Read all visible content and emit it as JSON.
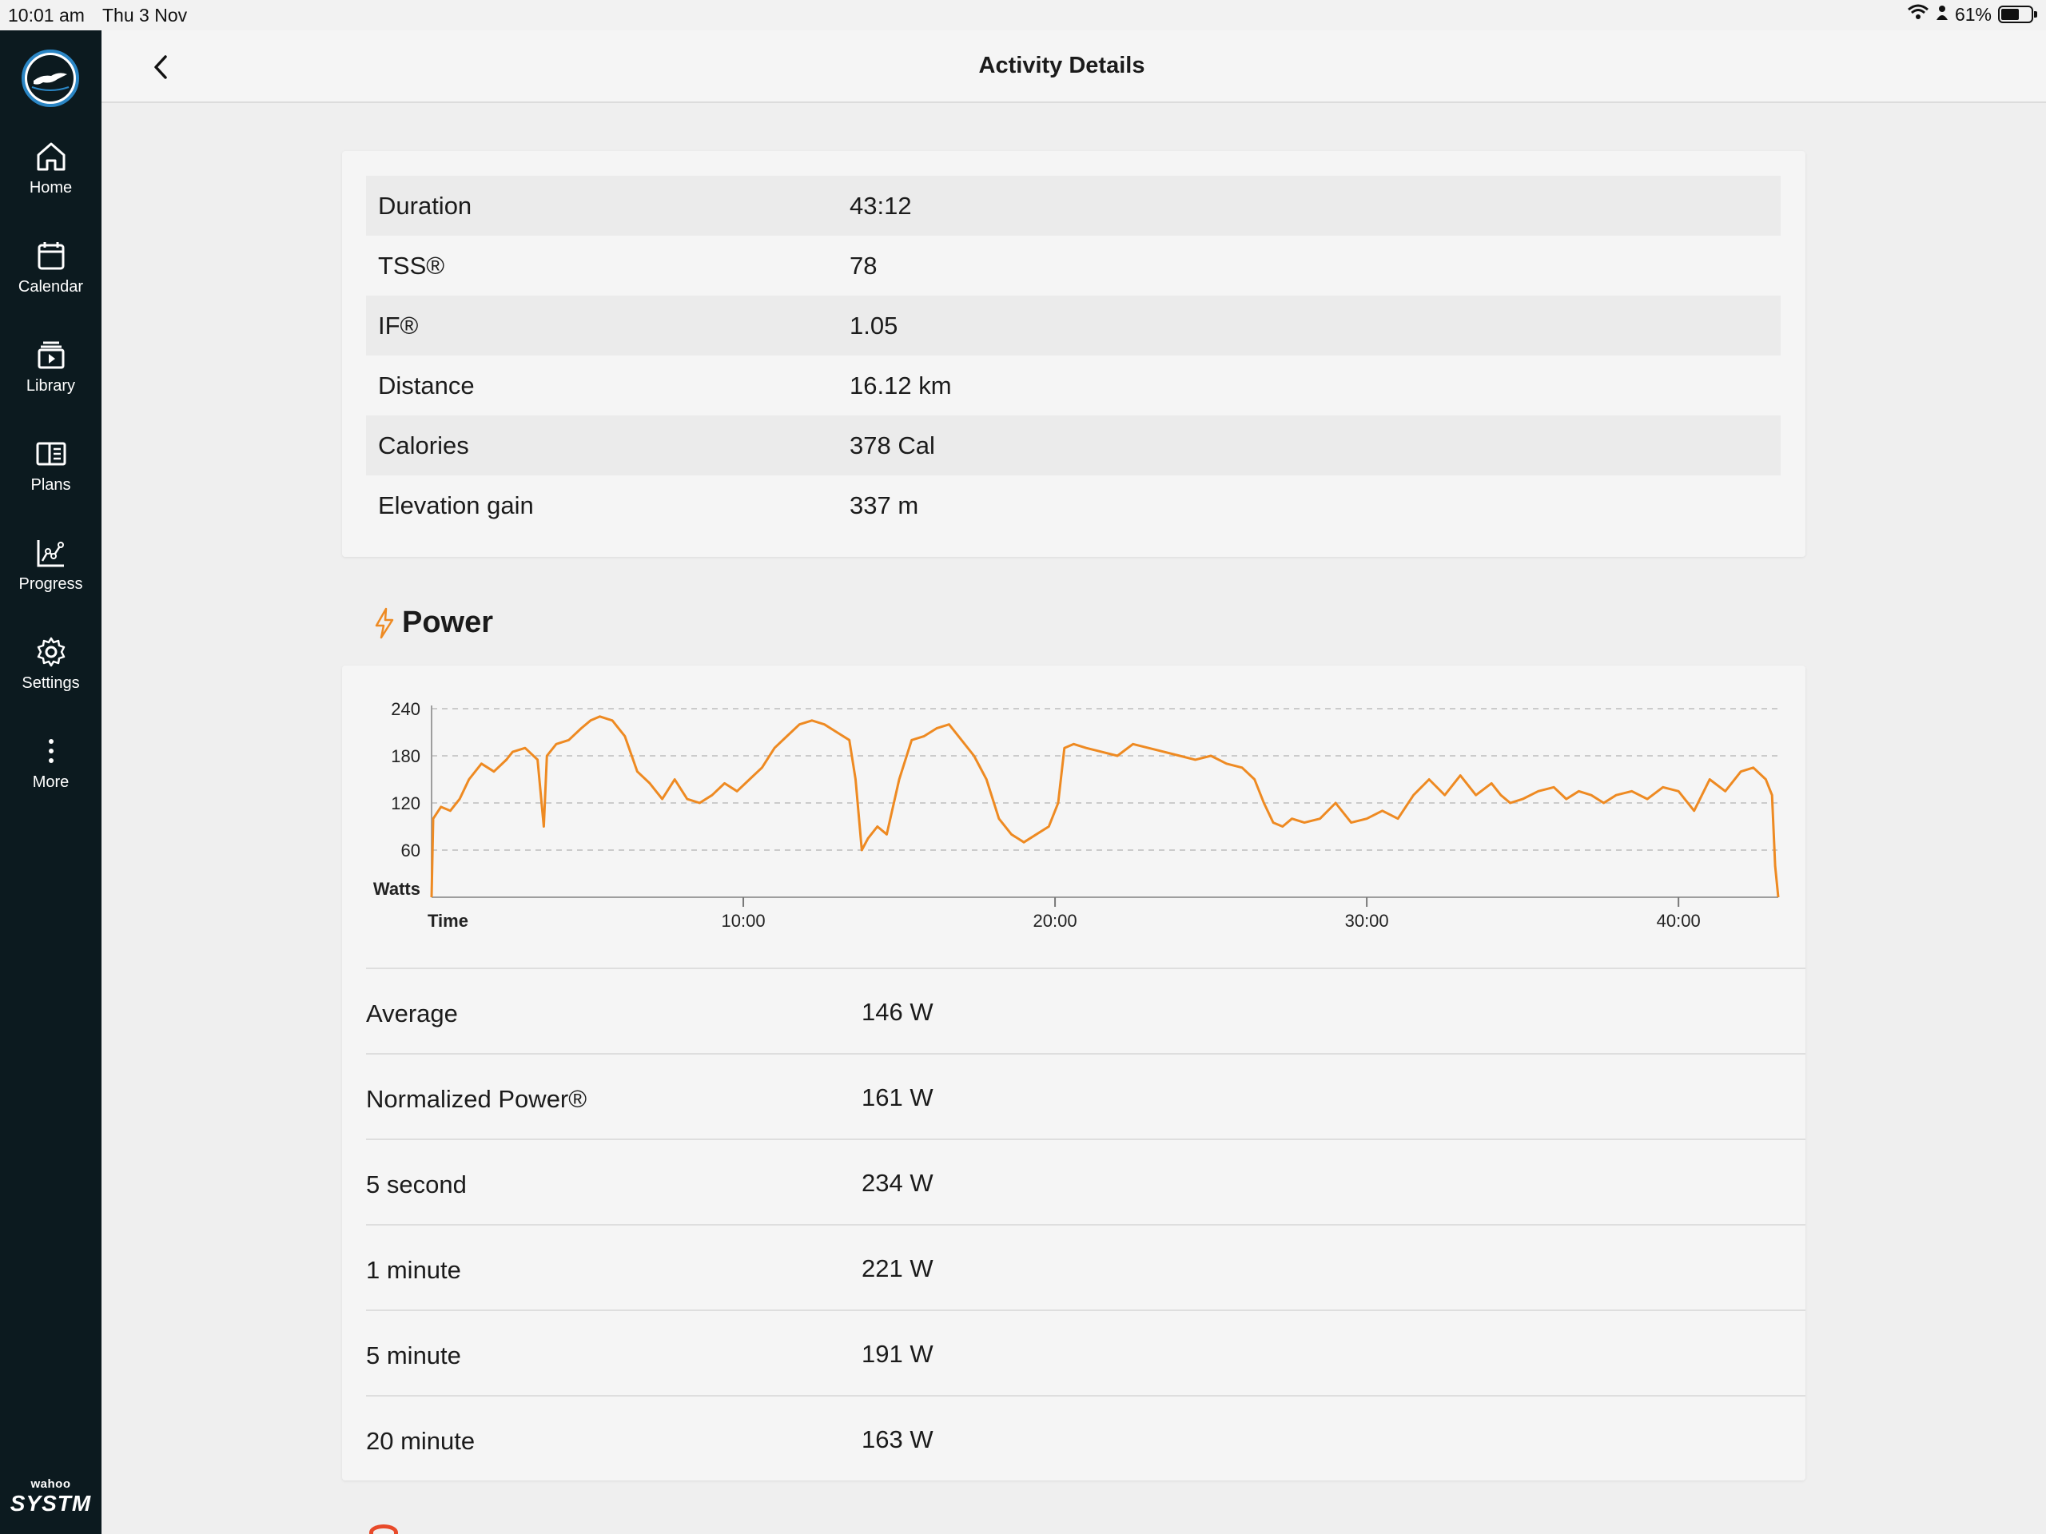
{
  "status_bar": {
    "time": "10:01 am",
    "date": "Thu 3 Nov",
    "battery": "61%",
    "battery_level": 0.61,
    "wifi_icon": "wifi-icon",
    "person_icon": "person-icon"
  },
  "sidebar": {
    "logo": "wahoo-logo",
    "items": [
      {
        "label": "Home",
        "icon": "home-icon"
      },
      {
        "label": "Calendar",
        "icon": "calendar-icon"
      },
      {
        "label": "Library",
        "icon": "library-icon"
      },
      {
        "label": "Plans",
        "icon": "plans-icon"
      },
      {
        "label": "Progress",
        "icon": "progress-icon"
      },
      {
        "label": "Settings",
        "icon": "gear-icon"
      },
      {
        "label": "More",
        "icon": "more-icon"
      }
    ],
    "brand_small": "wahoo",
    "brand_big": "SYSTM"
  },
  "header": {
    "title": "Activity Details",
    "back_icon": "chevron-left-icon"
  },
  "summary": {
    "rows": [
      {
        "label": "Duration",
        "value": "43:12"
      },
      {
        "label": "TSS®",
        "value": "78"
      },
      {
        "label": "IF®",
        "value": "1.05"
      },
      {
        "label": "Distance",
        "value": "16.12 km"
      },
      {
        "label": "Calories",
        "value": "378 Cal"
      },
      {
        "label": "Elevation gain",
        "value": "337 m"
      }
    ]
  },
  "power": {
    "heading": "Power",
    "icon": "lightning-icon",
    "accent_color": "#ee8a22",
    "stats": [
      {
        "label": "Average",
        "value": "146 W"
      },
      {
        "label": "Normalized Power®",
        "value": "161 W"
      },
      {
        "label": "5 second",
        "value": "234 W"
      },
      {
        "label": "1 minute",
        "value": "221 W"
      },
      {
        "label": "5 minute",
        "value": "191 W"
      },
      {
        "label": "20 minute",
        "value": "163 W"
      }
    ]
  },
  "chart_data": {
    "type": "line",
    "xlabel": "Time",
    "ylabel": "Watts",
    "x_unit": "minutes",
    "xlim": [
      0,
      43.2
    ],
    "ylim": [
      0,
      240
    ],
    "y_ticks": [
      60,
      120,
      180,
      240
    ],
    "x_ticks": [
      10,
      20,
      30,
      40
    ],
    "x_tick_labels": [
      "10:00",
      "20:00",
      "30:00",
      "40:00"
    ],
    "grid": true,
    "line_color": "#ee8a22",
    "series": [
      {
        "x": [
          0,
          0.05,
          0.3,
          0.6,
          0.9,
          1.2,
          1.6,
          2.0,
          2.4,
          2.6,
          3.0,
          3.4,
          3.6,
          3.7,
          4.0,
          4.4,
          4.8,
          5.1,
          5.4,
          5.8,
          6.2,
          6.6,
          7.0,
          7.4,
          7.8,
          8.2,
          8.6,
          9.0,
          9.4,
          9.8,
          10.2,
          10.6,
          11.0,
          11.4,
          11.8,
          12.2,
          12.6,
          13.0,
          13.4,
          13.6,
          13.8,
          14.0,
          14.3,
          14.6,
          15.0,
          15.4,
          15.8,
          16.2,
          16.6,
          17.0,
          17.4,
          17.8,
          18.2,
          18.6,
          19.0,
          19.4,
          19.8,
          20.1,
          20.3,
          20.6,
          21.0,
          21.5,
          22.0,
          22.5,
          23.0,
          23.5,
          24.0,
          24.5,
          25.0,
          25.5,
          26.0,
          26.4,
          26.7,
          27.0,
          27.3,
          27.6,
          28.0,
          28.5,
          29.0,
          29.5,
          30.0,
          30.5,
          31.0,
          31.5,
          32.0,
          32.5,
          33.0,
          33.5,
          34.0,
          34.3,
          34.6,
          35.0,
          35.5,
          36.0,
          36.4,
          36.8,
          37.2,
          37.6,
          38.0,
          38.5,
          39.0,
          39.5,
          40.0,
          40.5,
          41.0,
          41.5,
          42.0,
          42.4,
          42.8,
          43.0,
          43.1,
          43.2
        ],
        "y": [
          0,
          100,
          115,
          110,
          125,
          150,
          170,
          160,
          175,
          185,
          190,
          175,
          90,
          180,
          195,
          200,
          215,
          225,
          230,
          225,
          205,
          160,
          145,
          125,
          150,
          125,
          120,
          130,
          145,
          135,
          150,
          165,
          190,
          205,
          220,
          225,
          220,
          210,
          200,
          150,
          60,
          75,
          90,
          80,
          150,
          200,
          205,
          215,
          220,
          200,
          180,
          150,
          100,
          80,
          70,
          80,
          90,
          120,
          190,
          195,
          190,
          185,
          180,
          195,
          190,
          185,
          180,
          175,
          180,
          170,
          165,
          150,
          120,
          95,
          90,
          100,
          95,
          100,
          120,
          95,
          100,
          110,
          100,
          130,
          150,
          130,
          155,
          130,
          145,
          130,
          120,
          125,
          135,
          140,
          125,
          135,
          130,
          120,
          130,
          135,
          125,
          140,
          135,
          110,
          150,
          135,
          160,
          165,
          150,
          130,
          40,
          0
        ]
      }
    ]
  }
}
